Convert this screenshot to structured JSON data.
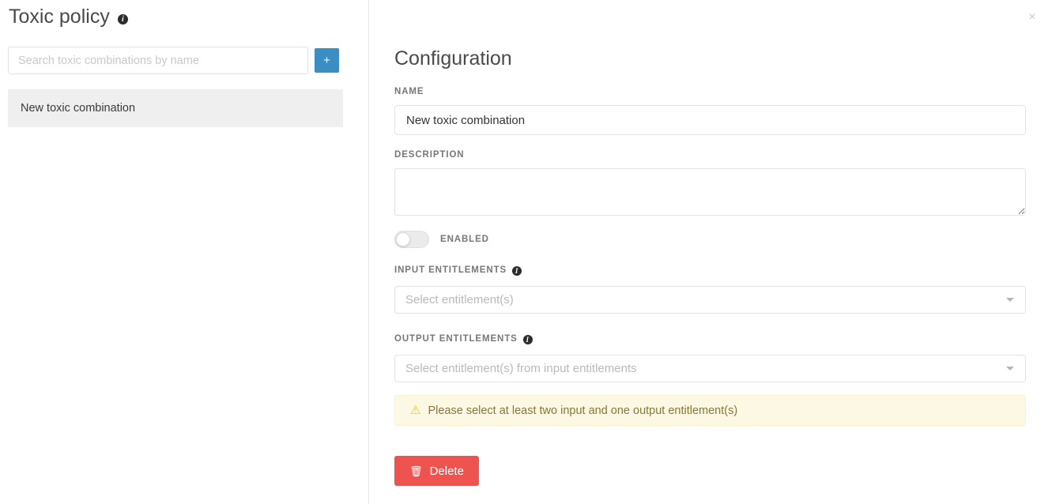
{
  "window": {
    "close_label": "×"
  },
  "left": {
    "title": "Toxic policy",
    "title_info_glyph": "i",
    "search": {
      "placeholder": "Search toxic combinations by name",
      "value": ""
    },
    "add_button_label": "+",
    "items": [
      {
        "label": "New toxic combination",
        "selected": true
      }
    ]
  },
  "config": {
    "heading": "Configuration",
    "name": {
      "label": "NAME",
      "value": "New toxic combination",
      "placeholder": ""
    },
    "description": {
      "label": "DESCRIPTION",
      "value": "",
      "placeholder": ""
    },
    "enabled": {
      "label": "ENABLED",
      "state": "off"
    },
    "input_entitlements": {
      "label": "INPUT ENTITLEMENTS",
      "info_glyph": "i",
      "placeholder": "Select entitlement(s)",
      "value": ""
    },
    "output_entitlements": {
      "label": "OUTPUT ENTITLEMENTS",
      "info_glyph": "i",
      "placeholder": "Select entitlement(s) from input entitlements",
      "value": ""
    },
    "alert": {
      "icon": "warning-triangle-icon",
      "icon_glyph": "⚠",
      "message": "Please select at least two input and one output entitlement(s)"
    },
    "delete_button": {
      "label": "Delete",
      "icon": "trash-icon",
      "icon_glyph": "🗑"
    }
  },
  "colors": {
    "accent_blue": "#3b8ec2",
    "danger_red": "#ef5350",
    "alert_bg": "#fcf8e3",
    "alert_text": "#8a7638",
    "warn_yellow": "#f0c419",
    "selected_row": "#efefef",
    "label_gray": "#777777"
  }
}
